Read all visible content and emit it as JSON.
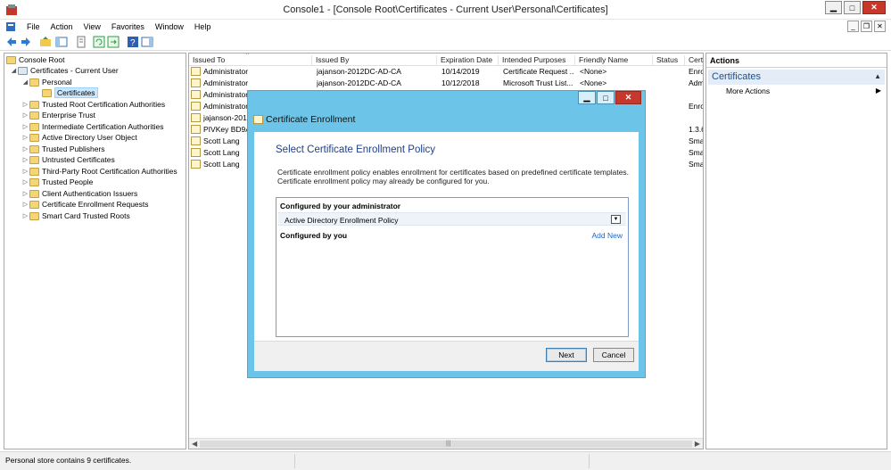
{
  "window": {
    "title": "Console1 - [Console Root\\Certificates - Current User\\Personal\\Certificates]"
  },
  "menu": [
    "File",
    "Action",
    "View",
    "Favorites",
    "Window",
    "Help"
  ],
  "tree": {
    "root": "Console Root",
    "store": "Certificates - Current User",
    "personal": "Personal",
    "certificates": "Certificates",
    "items": [
      "Trusted Root Certification Authorities",
      "Enterprise Trust",
      "Intermediate Certification Authorities",
      "Active Directory User Object",
      "Trusted Publishers",
      "Untrusted Certificates",
      "Third-Party Root Certification Authorities",
      "Trusted People",
      "Client Authentication Issuers",
      "Certificate Enrollment Requests",
      "Smart Card Trusted Roots"
    ]
  },
  "list": {
    "columns": [
      "Issued To",
      "Issued By",
      "Expiration Date",
      "Intended Purposes",
      "Friendly Name",
      "Status",
      "Certi"
    ],
    "rows": [
      {
        "issued_to": "Administrator",
        "issued_by": "jajanson-2012DC-AD-CA",
        "expiration": "10/14/2019",
        "purposes": "Certificate Request ...",
        "friendly": "<None>",
        "status": "",
        "cert": "Enro"
      },
      {
        "issued_to": "Administrator",
        "issued_by": "jajanson-2012DC-AD-CA",
        "expiration": "10/12/2018",
        "purposes": "Microsoft Trust List...",
        "friendly": "<None>",
        "status": "",
        "cert": "Adm"
      },
      {
        "issued_to": "Administrator",
        "cert": ""
      },
      {
        "issued_to": "Administrator",
        "cert": "Enro"
      },
      {
        "issued_to": "jajanson-2012",
        "cert": ""
      },
      {
        "issued_to": "PIVKey BD9A5",
        "cert": "1.3.6"
      },
      {
        "issued_to": "Scott Lang",
        "cert": "Sma"
      },
      {
        "issued_to": "Scott Lang",
        "cert": "Sma"
      },
      {
        "issued_to": "Scott Lang",
        "cert": "Sma"
      }
    ]
  },
  "actions": {
    "title": "Actions",
    "section": "Certificates",
    "item": "More Actions"
  },
  "status": {
    "text": "Personal store contains 9 certificates."
  },
  "dialog": {
    "title": "Certificate Enrollment",
    "heading": "Select Certificate Enrollment Policy",
    "description": "Certificate enrollment policy enables enrollment for certificates based on predefined certificate templates. Certificate enrollment policy may already be configured for you.",
    "admin_header": "Configured by your administrator",
    "policy_name": "Active Directory Enrollment Policy",
    "user_header": "Configured by you",
    "add_new": "Add New",
    "next": "Next",
    "cancel": "Cancel"
  }
}
